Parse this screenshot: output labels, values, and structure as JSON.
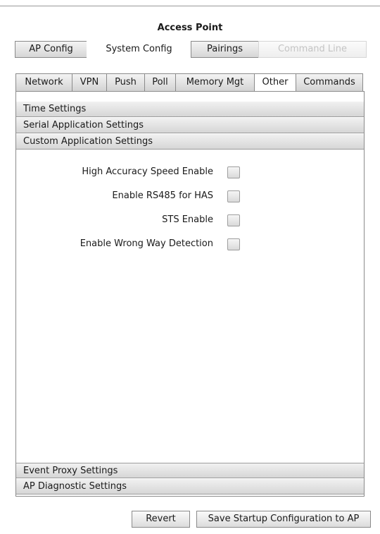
{
  "window": {
    "title": "Access Point"
  },
  "top_tabs": [
    {
      "label": "AP Config",
      "state": "normal"
    },
    {
      "label": "System Config",
      "state": "selected"
    },
    {
      "label": "Pairings",
      "state": "normal"
    },
    {
      "label": "Command Line",
      "state": "disabled"
    }
  ],
  "sub_tabs": [
    {
      "label": "Network"
    },
    {
      "label": "VPN"
    },
    {
      "label": "Push"
    },
    {
      "label": "Poll"
    },
    {
      "label": "Memory Mgt"
    },
    {
      "label": "Other",
      "selected": true
    },
    {
      "label": "Commands"
    }
  ],
  "sections": {
    "time": "Time Settings",
    "serial": "Serial Application Settings",
    "custom": "Custom Application Settings",
    "event_proxy": "Event Proxy Settings",
    "diagnostic": "AP Diagnostic Settings"
  },
  "custom_options": [
    {
      "label": "High Accuracy Speed Enable",
      "checked": false
    },
    {
      "label": "Enable RS485 for HAS",
      "checked": false
    },
    {
      "label": "STS Enable",
      "checked": false
    },
    {
      "label": "Enable Wrong Way Detection",
      "checked": false
    }
  ],
  "buttons": {
    "revert": "Revert",
    "save": "Save Startup Configuration to AP"
  }
}
